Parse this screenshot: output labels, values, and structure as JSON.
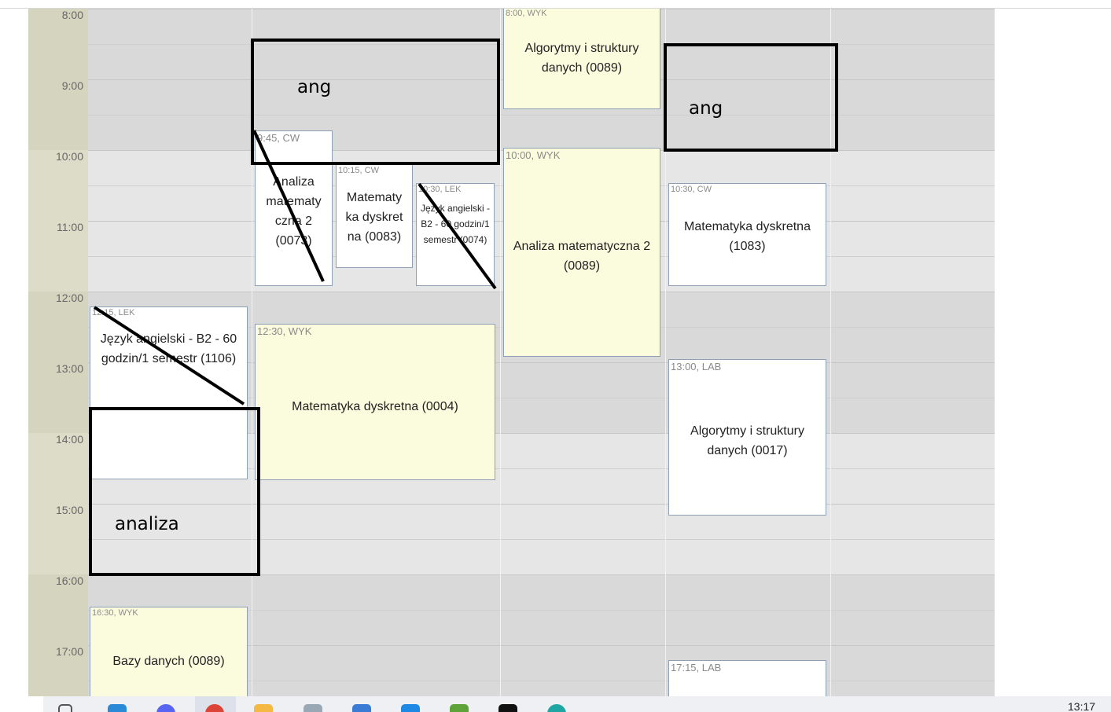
{
  "calendar": {
    "times": [
      "8:00",
      "9:00",
      "10:00",
      "11:00",
      "12:00",
      "13:00",
      "14:00",
      "15:00",
      "16:00",
      "17:00"
    ],
    "events": [
      {
        "id": "e1",
        "meta": "8:00, WYK",
        "title": "Algorytmy i struktury danych (0089)",
        "kind": "WYK"
      },
      {
        "id": "e2",
        "meta": "9:45, CW",
        "title": "Analiza matematy czna 2 (0073)",
        "kind": "CW"
      },
      {
        "id": "e3",
        "meta": "10:15, CW",
        "title": "Matematy ka dyskret na (0083)",
        "kind": "CW"
      },
      {
        "id": "e4",
        "meta": "10:30, LEK",
        "title": "Język angielski - B2 - 60 godzin/1 semestr (0074)",
        "kind": "LEK"
      },
      {
        "id": "e5",
        "meta": "10:00, WYK",
        "title": "Analiza matematyczna 2 (0089)",
        "kind": "WYK"
      },
      {
        "id": "e6",
        "meta": "10:30, CW",
        "title": "Matematyka dyskretna (1083)",
        "kind": "CW"
      },
      {
        "id": "e7",
        "meta": "12:15, LEK",
        "title": "Język angielski - B2 - 60 godzin/1 semestr (1106)",
        "kind": "LEK"
      },
      {
        "id": "e8",
        "meta": "12:30, WYK",
        "title": "Matematyka dyskretna (0004)",
        "kind": "WYK"
      },
      {
        "id": "e9",
        "meta": "13:00, LAB",
        "title": "Algorytmy i struktury danych (0017)",
        "kind": "LAB"
      },
      {
        "id": "e10",
        "meta": "16:30, WYK",
        "title": "Bazy danych (0089)",
        "kind": "WYK"
      },
      {
        "id": "e11",
        "meta": "17:15, LAB",
        "title": "",
        "kind": "LAB"
      }
    ]
  },
  "annotations": {
    "box1_label": "ang",
    "box2_label": "ang",
    "box3_label": "analiza"
  },
  "taskbar": {
    "clock": "13:17",
    "icons": [
      "windows-icon",
      "vscode-icon",
      "discord-icon",
      "chrome-icon",
      "file-explorer-icon",
      "notepad-icon",
      "monitor-icon",
      "info-icon",
      "terminal-icon",
      "media-icon",
      "edge-icon"
    ]
  },
  "colors": {
    "lecture_bg": "#fbfcde",
    "class_bg": "#ffffff",
    "event_border": "#8ea0b6",
    "grid_bg": "#d9d9d9"
  }
}
